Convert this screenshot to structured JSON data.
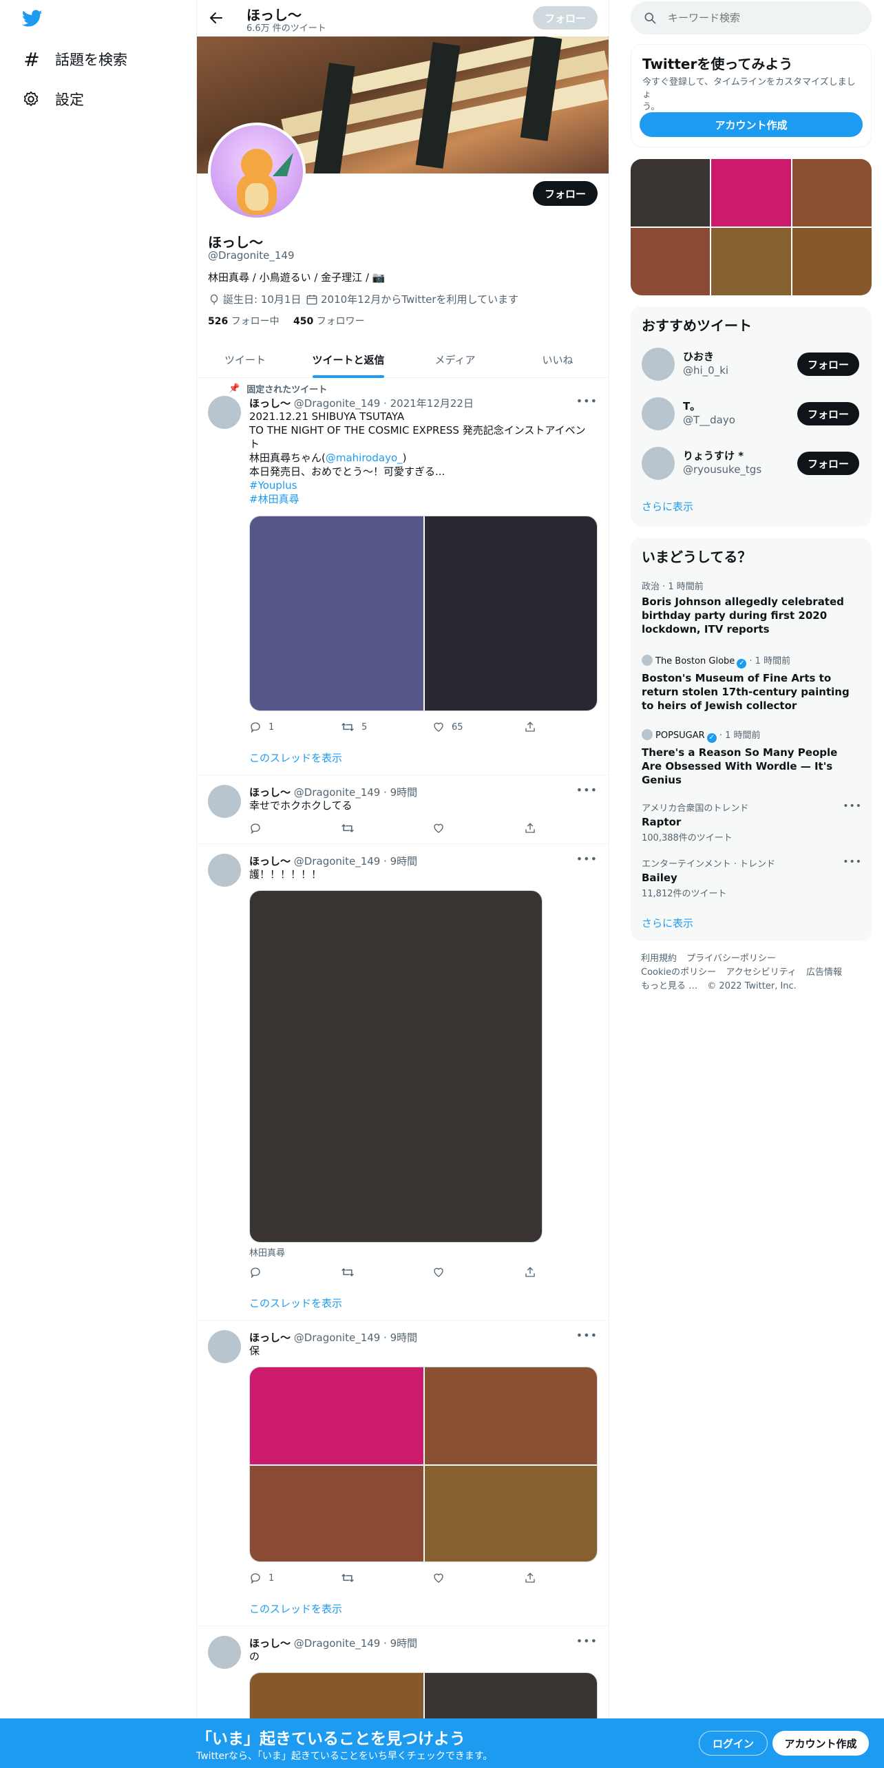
{
  "nav": {
    "explore_label": "話題を検索",
    "settings_label": "設定"
  },
  "header": {
    "name": "ほっし～",
    "tweet_count": "6.6万 件のツイート",
    "follow_label": "フォロー"
  },
  "profile": {
    "name": "ほっし～",
    "handle": "@Dragonite_149",
    "bio": "林田真尋 / 小鳥遊るい / 金子理江 / 📷",
    "birthday": "誕生日: 10月1日",
    "joined": "2010年12月からTwitterを利用しています",
    "following_count": "526",
    "following_label": "フォロー中",
    "followers_count": "450",
    "followers_label": "フォロワー",
    "follow_label": "フォロー"
  },
  "tabs": [
    "ツイート",
    "ツイートと返信",
    "メディア",
    "いいね"
  ],
  "tweets": [
    {
      "pinned_label": "固定されたツイート",
      "name": "ほっし～",
      "handle_time": "@Dragonite_149 · 2021年12月22日",
      "line1": "2021.12.21 SHIBUYA TSUTAYA",
      "line2": "TO THE NIGHT OF THE COSMIC EXPRESS 発売記念インストアイベン",
      "line3": "ト",
      "line4_pre": "林田真尋ちゃん(",
      "mention": "@mahirodayo_",
      "line4_post": ")",
      "line5": "本日発売日、おめでとう〜！可愛すぎる...",
      "hashtag1": "#Youplus",
      "hashtag2": "#林田真尋",
      "replies": "1",
      "retweets": "5",
      "likes": "65",
      "thread_label": "このスレッドを表示"
    },
    {
      "name": "ほっし～",
      "handle_time": "@Dragonite_149 · 9時間",
      "text": "幸せでホクホクしてる"
    },
    {
      "name": "ほっし～",
      "handle_time": "@Dragonite_149 · 9時間",
      "text": "護！！！！！！",
      "caption": "林田真尋",
      "thread_label": "このスレッドを表示"
    },
    {
      "name": "ほっし～",
      "handle_time": "@Dragonite_149 · 9時間",
      "text": "保",
      "replies": "1",
      "thread_label": "このスレッドを表示"
    },
    {
      "name": "ほっし～",
      "handle_time": "@Dragonite_149 · 9時間",
      "text": "の"
    }
  ],
  "search": {
    "placeholder": "キーワード検索"
  },
  "signup": {
    "title": "Twitterを使ってみよう",
    "desc_line1": "今すぐ登録して、タイムラインをカスタマイズしましょ",
    "desc_line2": "う。",
    "button_label": "アカウント作成"
  },
  "recommended": {
    "title": "おすすめツイート",
    "users": [
      {
        "name": "ひおき",
        "handle": "@hi_0_ki"
      },
      {
        "name": "T。",
        "handle": "@T__dayo"
      },
      {
        "name": "りょうすけ *",
        "handle": "@ryousuke_tgs"
      }
    ],
    "follow_label": "フォロー",
    "more_label": "さらに表示"
  },
  "trends": {
    "title": "いまどうしてる？",
    "items": [
      {
        "meta": "政治 · 1 時間前",
        "title_l1": "Boris Johnson allegedly celebrated",
        "title_l2": "birthday party during first 2020",
        "title_l3": "lockdown, ITV reports"
      },
      {
        "source": "The Boston Globe",
        "time": " · 1 時間前",
        "title_l1": "Boston's Museum of Fine Arts to",
        "title_l2": "return stolen 17th-century painting",
        "title_l3": "to heirs of Jewish collector"
      },
      {
        "source": "POPSUGAR",
        "time": " · 1 時間前",
        "title_l1": "There's a Reason So Many People",
        "title_l2": "Are Obsessed With Wordle — It's",
        "title_l3": "Genius"
      },
      {
        "meta": "アメリカ合衆国のトレンド",
        "title_l1": "Raptor",
        "count": "100,388件のツイート"
      },
      {
        "meta": "エンターテインメント · トレンド",
        "title_l1": "Bailey",
        "count": "11,812件のツイート"
      }
    ],
    "more_label": "さらに表示"
  },
  "footer": {
    "terms": "利用規約",
    "privacy": "プライバシーポリシー",
    "cookie": "Cookieのポリシー",
    "accessibility": "アクセシビリティ",
    "ads": "広告情報",
    "more": "もっと見る …",
    "copyright": "© 2022 Twitter, Inc."
  },
  "bottom_bar": {
    "title": "「いま」起きていることを見つけよう",
    "subtitle": "Twitterなら、「いま」起きていることをいち早くチェックできます。",
    "login_label": "ログイン",
    "signup_label": "アカウント作成"
  },
  "colors": {
    "accent": "#1d9bf0",
    "dark": "#0f1419",
    "banner_photo": "#8a5b3a",
    "media_1a": "#565688",
    "media_1b": "#2a2730",
    "media_2": "#393432",
    "media_3": [
      "#cc1a6c",
      "#8b5032",
      "#8b4a34",
      "#87602f"
    ],
    "media_4": [
      "#87582a",
      "#393432"
    ],
    "grid_colors": [
      "#393432",
      "#cc1a6c",
      "#8b5032",
      "#8b4a34",
      "#87602f",
      "#87582a"
    ]
  }
}
